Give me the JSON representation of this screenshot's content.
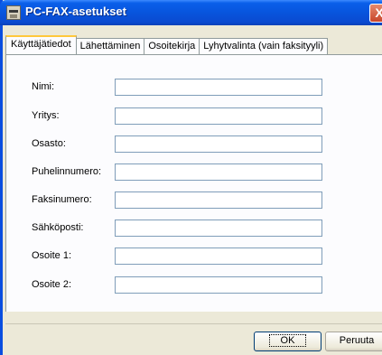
{
  "window": {
    "title": "PC-FAX-asetukset",
    "close_label": "X"
  },
  "tabs": [
    {
      "label": "Käyttäjätiedot",
      "active": true
    },
    {
      "label": "Lähettäminen",
      "active": false
    },
    {
      "label": "Osoitekirja",
      "active": false
    },
    {
      "label": "Lyhytvalinta (vain faksityyli)",
      "active": false
    }
  ],
  "fields": [
    {
      "label": "Nimi:",
      "value": ""
    },
    {
      "label": "Yritys:",
      "value": ""
    },
    {
      "label": "Osasto:",
      "value": ""
    },
    {
      "label": "Puhelinnumero:",
      "value": ""
    },
    {
      "label": "Faksinumero:",
      "value": ""
    },
    {
      "label": "Sähköposti:",
      "value": ""
    },
    {
      "label": "Osoite 1:",
      "value": ""
    },
    {
      "label": "Osoite 2:",
      "value": ""
    }
  ],
  "buttons": {
    "ok": "OK",
    "cancel": "Peruuta"
  }
}
